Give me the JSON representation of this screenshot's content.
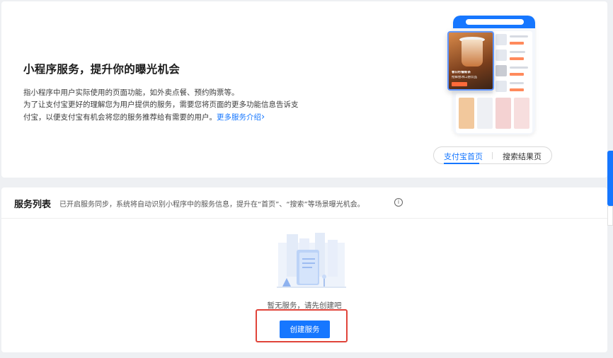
{
  "intro": {
    "title": "小程序服务，提升你的曝光机会",
    "desc_line1": "指小程序中用户实际使用的页面功能，如外卖点餐、预约购票等。",
    "desc_line2": "为了让支付宝更好的理解您为用户提供的服务，需要您将页面的更多功能信息告诉支付宝，以便支付宝有机会将您的服务推荐给有需要的用户。",
    "more_link": "更多服务介绍",
    "more_link_chevron": "›",
    "preview_tabs": [
      "支付宝首页",
      "搜索结果页"
    ],
    "active_tab": "支付宝首页",
    "promo_text": "春日柠檬新茶",
    "promo_sub": "抢鲜尝冰口感饮品"
  },
  "service_list": {
    "title": "服务列表",
    "description": "已开启服务同步，系统将自动识别小程序中的服务信息，提升在“首页”、“搜索”等场景曝光机会。",
    "info_icon": "i",
    "empty_text": "暂无服务，请先创建吧",
    "create_button": "创建服务"
  },
  "colors": {
    "accent": "#1677ff",
    "highlight_border": "#e0443a",
    "page_bg": "#eef0f3"
  }
}
